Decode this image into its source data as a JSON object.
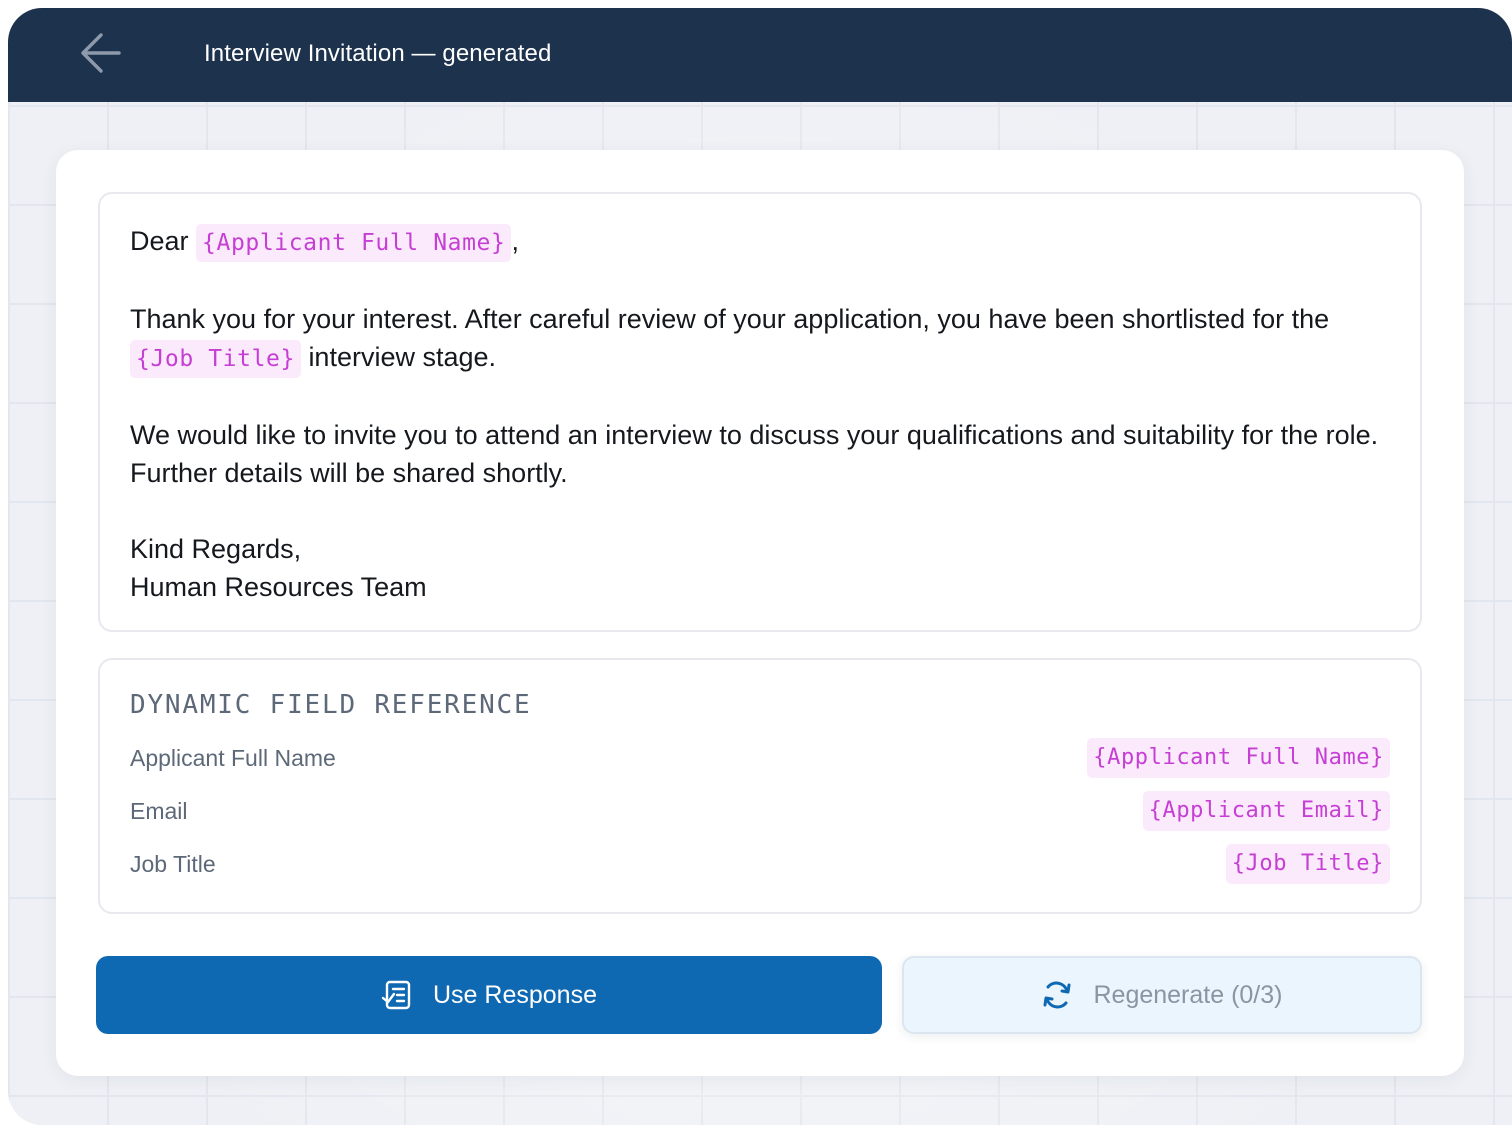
{
  "header": {
    "title": "Interview Invitation — generated",
    "back_icon": "arrow-left-icon"
  },
  "letter": {
    "greeting": "Dear",
    "greeting_field": "{Applicant Full Name}",
    "greeting_punct": ",",
    "para1_text": "Thank you for your interest. After careful review of your application, you have been shortlisted for the",
    "para1_field": "{Job Title}",
    "para1_end": "interview stage.",
    "para2": "We would like to invite you to attend an interview to discuss your qualifications and suitability for the role. Further details will be shared shortly.",
    "closing": "Kind Regards,",
    "signature": "Human Resources Team"
  },
  "field_reference": {
    "heading": "DYNAMIC FIELD REFERENCE",
    "rows": [
      {
        "label": "Applicant Full Name",
        "token": "{Applicant Full Name}"
      },
      {
        "label": "Email",
        "token": "{Applicant Email}"
      },
      {
        "label": "Job Title",
        "token": "{Job Title}"
      }
    ]
  },
  "actions": {
    "use_response": {
      "label": "Use Response",
      "icon": "document-list-icon"
    },
    "regenerate": {
      "label": "Regenerate (0/3)",
      "icon": "refresh-icon"
    }
  },
  "colors": {
    "header_bg": "#1c324d",
    "primary": "#0f69b2",
    "token_text": "#c63fd4",
    "token_bg": "#fbeafc"
  }
}
